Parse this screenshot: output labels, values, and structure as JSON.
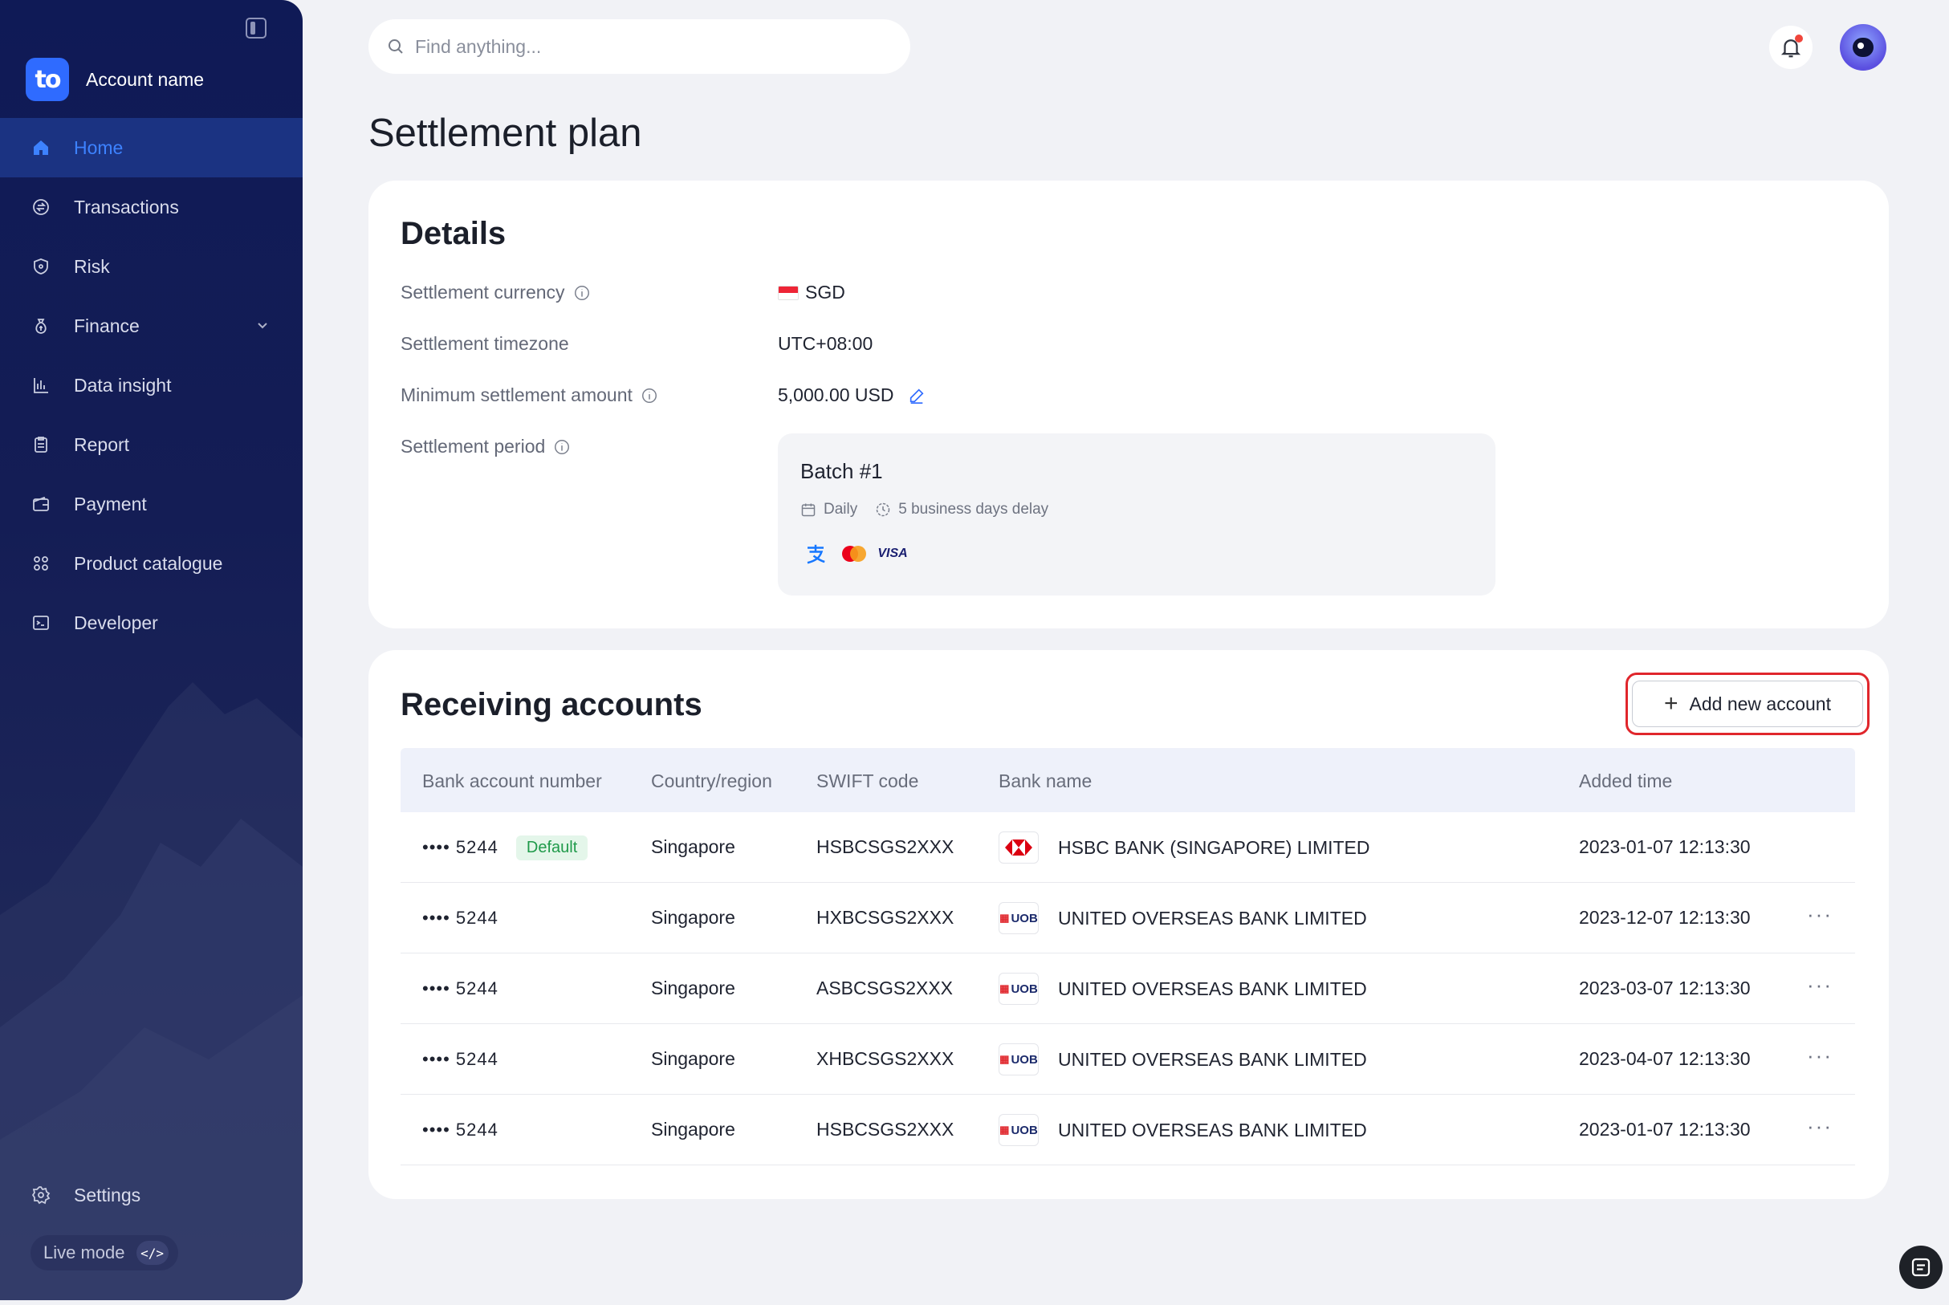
{
  "sidebar": {
    "account_name": "Account name",
    "logo_text": "to",
    "items": [
      {
        "label": "Home",
        "icon": "home-icon",
        "active": true
      },
      {
        "label": "Transactions",
        "icon": "transactions-icon"
      },
      {
        "label": "Risk",
        "icon": "shield-icon"
      },
      {
        "label": "Finance",
        "icon": "money-bag-icon",
        "expandable": true
      },
      {
        "label": "Data insight",
        "icon": "chart-icon"
      },
      {
        "label": "Report",
        "icon": "report-icon"
      },
      {
        "label": "Payment",
        "icon": "wallet-icon"
      },
      {
        "label": "Product catalogue",
        "icon": "grid-icon"
      },
      {
        "label": "Developer",
        "icon": "terminal-icon"
      }
    ],
    "settings_label": "Settings",
    "live_mode_label": "Live mode",
    "live_mode_code": "</>"
  },
  "search": {
    "placeholder": "Find anything..."
  },
  "page": {
    "title": "Settlement plan"
  },
  "details": {
    "title": "Details",
    "rows": [
      {
        "label": "Settlement currency",
        "value": "SGD"
      },
      {
        "label": "Settlement timezone",
        "value": "UTC+08:00"
      },
      {
        "label": "Minimum settlement amount",
        "value": "5,000.00 USD"
      },
      {
        "label": "Settlement period"
      }
    ],
    "batch": {
      "title": "Batch #1",
      "frequency": "Daily",
      "delay": "5 business days delay",
      "payment_methods": [
        "alipay-icon",
        "mastercard-icon",
        "visa-icon"
      ],
      "visa_text": "VISA"
    }
  },
  "accounts": {
    "title": "Receiving accounts",
    "add_button": "Add new account",
    "columns": [
      "Bank account number",
      "Country/region",
      "SWIFT code",
      "Bank name",
      "Added time"
    ],
    "rows": [
      {
        "number": "•••• 5244",
        "badge": "Default",
        "country": "Singapore",
        "swift": "HSBCSGS2XXX",
        "bank": "HSBC BANK (SINGAPORE) LIMITED",
        "logo": "hsbc",
        "added": "2023-01-07 12:13:30",
        "more": false
      },
      {
        "number": "•••• 5244",
        "badge": "",
        "country": "Singapore",
        "swift": "HXBCSGS2XXX",
        "bank": "UNITED OVERSEAS BANK LIMITED",
        "logo": "uob",
        "added": "2023-12-07 12:13:30",
        "more": true
      },
      {
        "number": "•••• 5244",
        "badge": "",
        "country": "Singapore",
        "swift": "ASBCSGS2XXX",
        "bank": "UNITED OVERSEAS BANK LIMITED",
        "logo": "uob",
        "added": "2023-03-07 12:13:30",
        "more": true
      },
      {
        "number": "•••• 5244",
        "badge": "",
        "country": "Singapore",
        "swift": "XHBCSGS2XXX",
        "bank": "UNITED OVERSEAS BANK LIMITED",
        "logo": "uob",
        "added": "2023-04-07 12:13:30",
        "more": true
      },
      {
        "number": "•••• 5244",
        "badge": "",
        "country": "Singapore",
        "swift": "HSBCSGS2XXX",
        "bank": "UNITED OVERSEAS BANK LIMITED",
        "logo": "uob",
        "added": "2023-01-07 12:13:30",
        "more": true
      }
    ],
    "uob_text": "UOB",
    "more_glyph": "···"
  },
  "colors": {
    "accent": "#2f6bff",
    "sidebar": "#0f1a56",
    "highlight": "#e0262c",
    "badge_bg": "#e4f6ea",
    "badge_fg": "#1f9a4a"
  }
}
